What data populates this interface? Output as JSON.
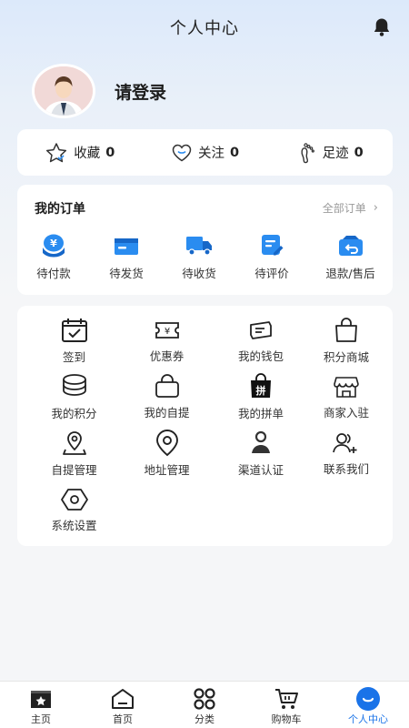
{
  "header": {
    "title": "个人中心"
  },
  "profile": {
    "login_label": "请登录"
  },
  "stats": [
    {
      "label": "收藏",
      "count": "0"
    },
    {
      "label": "关注",
      "count": "0"
    },
    {
      "label": "足迹",
      "count": "0"
    }
  ],
  "orders": {
    "title": "我的订单",
    "view_all": "全部订单",
    "items": [
      {
        "label": "待付款",
        "icon": "yen-wallet-icon"
      },
      {
        "label": "待发货",
        "icon": "card-icon"
      },
      {
        "label": "待收货",
        "icon": "truck-icon"
      },
      {
        "label": "待评价",
        "icon": "edit-note-icon"
      },
      {
        "label": "退款/售后",
        "icon": "refund-icon"
      }
    ]
  },
  "services": [
    {
      "label": "签到",
      "icon": "calendar-check-icon"
    },
    {
      "label": "优惠券",
      "icon": "coupon-icon"
    },
    {
      "label": "我的钱包",
      "icon": "wallet-icon"
    },
    {
      "label": "积分商城",
      "icon": "shopping-bag-icon"
    },
    {
      "label": "我的积分",
      "icon": "coin-stack-icon"
    },
    {
      "label": "我的自提",
      "icon": "basket-icon"
    },
    {
      "label": "我的拼单",
      "icon": "group-buy-icon"
    },
    {
      "label": "商家入驻",
      "icon": "store-icon"
    },
    {
      "label": "自提管理",
      "icon": "pickup-location-icon"
    },
    {
      "label": "地址管理",
      "icon": "map-pin-icon"
    },
    {
      "label": "渠道认证",
      "icon": "user-verify-icon"
    },
    {
      "label": "联系我们",
      "icon": "contact-users-icon"
    },
    {
      "label": "系统设置",
      "icon": "settings-hexagon-icon"
    }
  ],
  "tabbar": [
    {
      "label": "主页",
      "icon": "home-star-icon"
    },
    {
      "label": "首页",
      "icon": "home-icon"
    },
    {
      "label": "分类",
      "icon": "category-icon"
    },
    {
      "label": "购物车",
      "icon": "cart-icon"
    },
    {
      "label": "个人中心",
      "icon": "profile-smile-icon"
    }
  ],
  "colors": {
    "accent": "#1a73e8",
    "order_icon": "#2a8cf0"
  }
}
